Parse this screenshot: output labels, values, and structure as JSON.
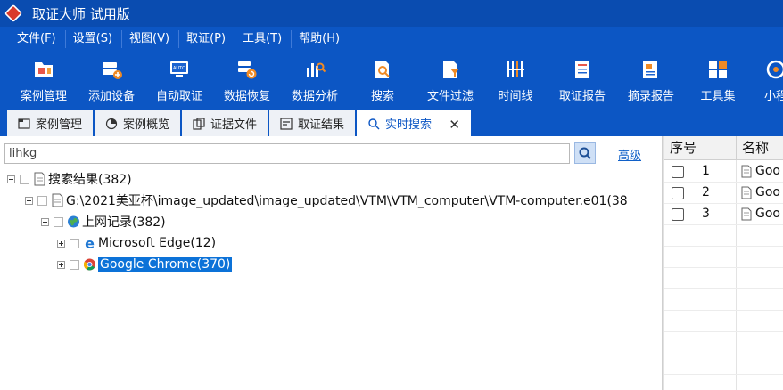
{
  "app": {
    "title": "取证大师 试用版"
  },
  "menu": [
    "文件(F)",
    "设置(S)",
    "视图(V)",
    "取证(P)",
    "工具(T)",
    "帮助(H)"
  ],
  "toolbar": [
    {
      "label": "案例管理",
      "icon": "folder-case-icon"
    },
    {
      "label": "添加设备",
      "icon": "add-device-icon"
    },
    {
      "label": "自动取证",
      "icon": "auto-monitor-icon"
    },
    {
      "label": "数据恢复",
      "icon": "data-recovery-icon"
    },
    {
      "label": "数据分析",
      "icon": "data-analysis-icon"
    },
    {
      "label": "搜索",
      "icon": "search-doc-icon"
    },
    {
      "label": "文件过滤",
      "icon": "file-filter-icon"
    },
    {
      "label": "时间线",
      "icon": "timeline-icon"
    },
    {
      "label": "取证报告",
      "icon": "report-icon"
    },
    {
      "label": "摘录报告",
      "icon": "excerpt-report-icon"
    },
    {
      "label": "工具集",
      "icon": "toolkit-icon"
    },
    {
      "label": "小程",
      "icon": "miniapp-icon"
    }
  ],
  "tabs": [
    {
      "label": "案例管理",
      "icon": "case-tab-icon"
    },
    {
      "label": "案例概览",
      "icon": "overview-tab-icon"
    },
    {
      "label": "证据文件",
      "icon": "evidence-tab-icon"
    },
    {
      "label": "取证结果",
      "icon": "result-tab-icon"
    },
    {
      "label": "实时搜索",
      "icon": "search-tab-icon",
      "active": true
    }
  ],
  "search": {
    "value": "lihkg",
    "advanced_label": "高级"
  },
  "tree": {
    "root": "搜索结果(382)",
    "image": "G:\\2021美亚杯\\image_updated\\image_updated\\VTM\\VTM_computer\\VTM-computer.e01(38",
    "category": "上网记录(382)",
    "edge": "Microsoft Edge(12)",
    "chrome": "Google Chrome(370)"
  },
  "grid": {
    "col_index": "序号",
    "col_name": "名称",
    "rows": [
      {
        "index": "1",
        "name": "Goo"
      },
      {
        "index": "2",
        "name": "Goo"
      },
      {
        "index": "3",
        "name": "Goo"
      }
    ]
  },
  "colors": {
    "brand": "#0c56c4",
    "titlebar": "#0a4cb0",
    "selection": "#0c72d8",
    "link": "#1060c8"
  }
}
